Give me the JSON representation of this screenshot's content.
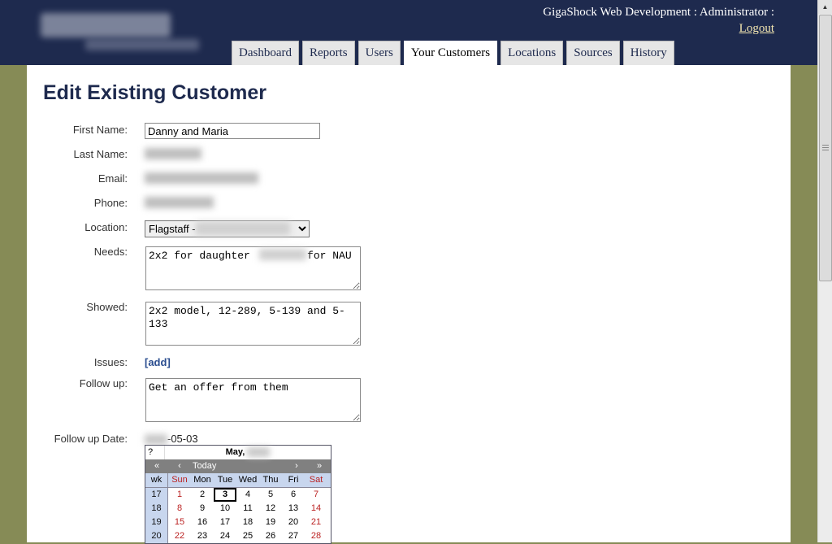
{
  "header": {
    "company_text": "GigaShock Web Development : Administrator :",
    "logout_label": "Logout"
  },
  "tabs": [
    {
      "label": "Dashboard"
    },
    {
      "label": "Reports"
    },
    {
      "label": "Users"
    },
    {
      "label": "Your Customers",
      "active": true
    },
    {
      "label": "Locations"
    },
    {
      "label": "Sources"
    },
    {
      "label": "History"
    }
  ],
  "page": {
    "title": "Edit Existing Customer"
  },
  "form": {
    "first_name_label": "First Name:",
    "first_name_value": "Danny and Maria",
    "last_name_label": "Last Name:",
    "email_label": "Email:",
    "phone_label": "Phone:",
    "location_label": "Location:",
    "location_value": "Flagstaff -",
    "needs_label": "Needs:",
    "needs_value": "2x2 for daughter         for NAU",
    "showed_label": "Showed:",
    "showed_value": "2x2 model, 12-289, 5-139 and 5-133",
    "issues_label": "Issues:",
    "issues_add": "[add]",
    "follow_up_label": "Follow up:",
    "follow_up_value": "Get an offer from them",
    "follow_up_date_label": "Follow up Date:",
    "follow_up_date_value": "-05-03"
  },
  "calendar": {
    "help": "?",
    "month_label": "May,",
    "nav_prev_year": "«",
    "nav_prev_month": "‹",
    "nav_today": "Today",
    "nav_next_month": "›",
    "nav_next_year": "»",
    "week_header": "wk",
    "days": [
      "Sun",
      "Mon",
      "Tue",
      "Wed",
      "Thu",
      "Fri",
      "Sat"
    ],
    "weeks": [
      {
        "wk": "17",
        "d": [
          "1",
          "2",
          "3",
          "4",
          "5",
          "6",
          "7"
        ]
      },
      {
        "wk": "18",
        "d": [
          "8",
          "9",
          "10",
          "11",
          "12",
          "13",
          "14"
        ]
      },
      {
        "wk": "19",
        "d": [
          "15",
          "16",
          "17",
          "18",
          "19",
          "20",
          "21"
        ]
      },
      {
        "wk": "20",
        "d": [
          "22",
          "23",
          "24",
          "25",
          "26",
          "27",
          "28"
        ]
      }
    ]
  },
  "colors": {
    "header_bg": "#1e2a4e",
    "page_bg": "#868b56",
    "title": "#1e2a4e"
  },
  "icons": {
    "scroll_up": "triangle-up-icon",
    "scroll_grip": "grip-lines-icon"
  }
}
